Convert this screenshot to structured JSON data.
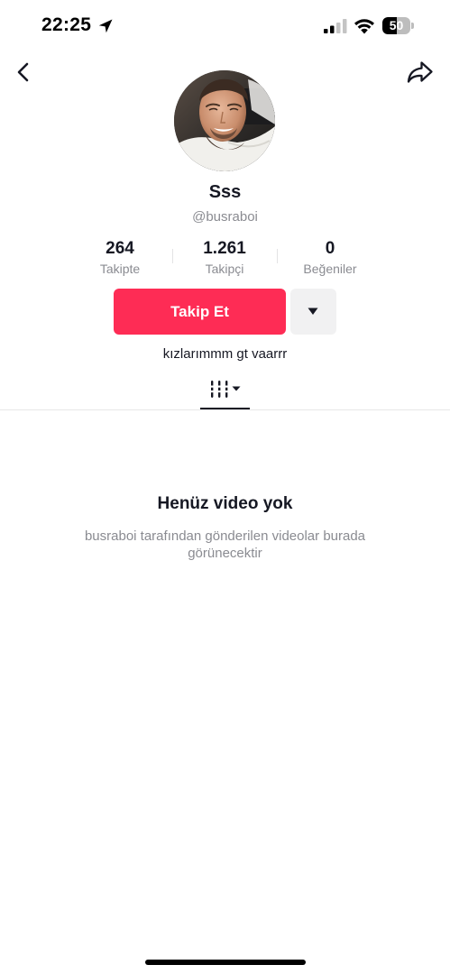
{
  "status_bar": {
    "time": "22:25",
    "battery_level": "50",
    "battery_fraction": 0.5,
    "icons": [
      "location-arrow-icon",
      "cellular-signal-icon",
      "wifi-icon",
      "battery-icon"
    ]
  },
  "nav": {
    "back_icon": "chevron-left-icon",
    "share_icon": "share-arrow-icon"
  },
  "profile": {
    "display_name": "Sss",
    "username": "@busraboi",
    "bio": "kızlarımmm gt vaarrr"
  },
  "stats": [
    {
      "value": "264",
      "label": "Takipte"
    },
    {
      "value": "1.261",
      "label": "Takipçi"
    },
    {
      "value": "0",
      "label": "Beğeniler"
    }
  ],
  "actions": {
    "follow_label": "Takip Et",
    "more_icon": "caret-down-icon"
  },
  "tabs": {
    "active_icon": "video-grid-icon"
  },
  "empty_state": {
    "title": "Henüz video yok",
    "subtitle": "busraboi tarafından gönderilen videolar burada görünecektir"
  },
  "colors": {
    "accent": "#fe2c55",
    "text_primary": "#161823",
    "text_secondary": "#8a8b91",
    "secondary_button_bg": "#f1f1f2"
  }
}
